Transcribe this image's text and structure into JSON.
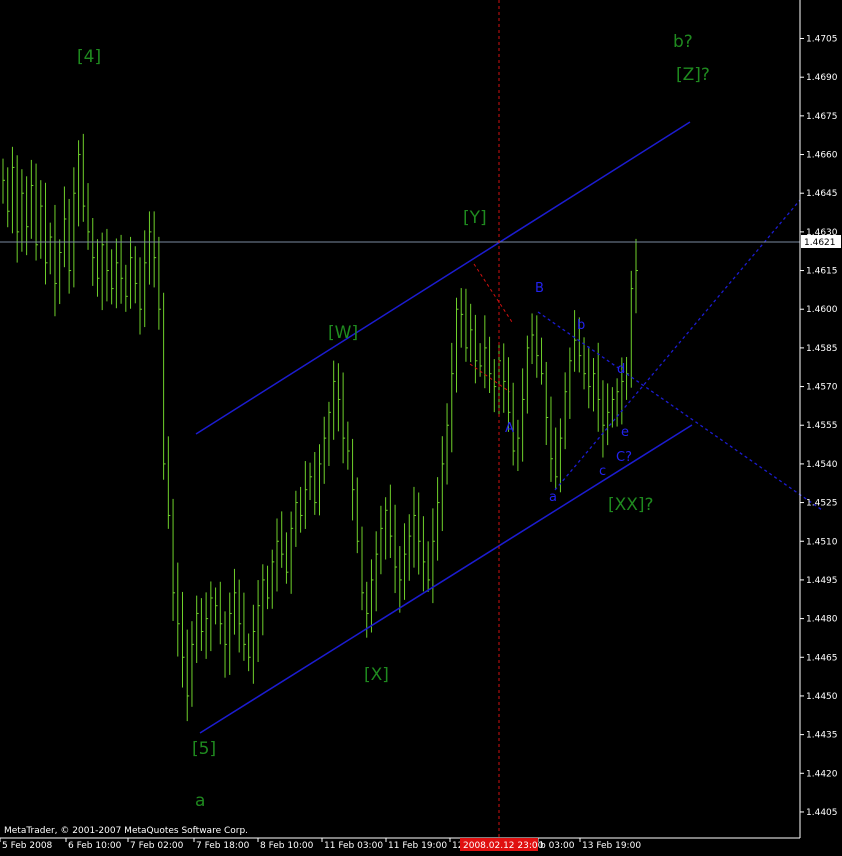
{
  "chart_data": {
    "type": "line",
    "title": "",
    "price_axis": {
      "ticks": [
        "1.4705",
        "1.4690",
        "1.4675",
        "1.4660",
        "1.4645",
        "1.4630",
        "1.4615",
        "1.4600",
        "1.4585",
        "1.4570",
        "1.4555",
        "1.4540",
        "1.4525",
        "1.4510",
        "1.4495",
        "1.4480",
        "1.4465",
        "1.4450",
        "1.4435",
        "1.4420",
        "1.4405"
      ],
      "current_price": "1.4621",
      "ylim": [
        1.4398,
        1.4718
      ]
    },
    "time_axis": {
      "ticks": [
        "5 Feb 2008",
        "6 Feb 10:00",
        "7 Feb 02:00",
        "7 Feb 18:00",
        "8 Feb 10:00",
        "11 Feb 03:00",
        "11 Feb 19:00",
        "12",
        "b 03:00",
        "13 Feb 19:00"
      ],
      "cursor_label": "2008.02.12 23:00"
    },
    "series": [
      {
        "values": [
          1.465,
          1.4638,
          1.4655,
          1.463,
          1.4645,
          1.4632,
          1.4648,
          1.4625,
          1.464,
          1.4618,
          1.4628,
          1.461,
          1.4622,
          1.4635,
          1.4615,
          1.4645,
          1.466,
          1.464,
          1.463,
          1.462,
          1.4612,
          1.4625,
          1.4615,
          1.4608,
          1.4618,
          1.4612,
          1.4605,
          1.462,
          1.461,
          1.46,
          1.4618,
          1.463,
          1.462,
          1.46,
          1.454,
          1.452,
          1.449,
          1.4478,
          1.4465,
          1.445,
          1.447,
          1.4482,
          1.4475,
          1.448,
          1.4488,
          1.4485,
          1.4478,
          1.447,
          1.4482,
          1.449,
          1.4478,
          1.447,
          1.4465,
          1.4475,
          1.4485,
          1.4495,
          1.4488,
          1.4502,
          1.451,
          1.4505,
          1.4498,
          1.4515,
          1.4525,
          1.452,
          1.453,
          1.4535,
          1.4525,
          1.454,
          1.455,
          1.456,
          1.4572,
          1.4565,
          1.455,
          1.4545,
          1.453,
          1.451,
          1.449,
          1.4482,
          1.4495,
          1.4505,
          1.4515,
          1.4522,
          1.4512,
          1.45,
          1.4495,
          1.4505,
          1.4512,
          1.452,
          1.451,
          1.4502,
          1.4495,
          1.451,
          1.4525,
          1.454,
          1.4555,
          1.4575,
          1.46,
          1.4598,
          1.4585,
          1.4592,
          1.458,
          1.4578,
          1.4585,
          1.4575,
          1.457,
          1.458,
          1.4572,
          1.456,
          1.4545,
          1.455,
          1.4565,
          1.4585,
          1.459,
          1.4582,
          1.4575,
          1.4558,
          1.4542,
          1.4535,
          1.455,
          1.4568,
          1.458,
          1.4588,
          1.4582,
          1.4575,
          1.457,
          1.4575,
          1.4565,
          1.4555,
          1.456,
          1.4565,
          1.4568,
          1.4572,
          1.4575,
          1.4608,
          1.4615
        ]
      }
    ],
    "wave_labels": [
      "[4]",
      "[5]",
      "a",
      "[W]",
      "[X]",
      "[Y]",
      "[Z]?",
      "b?",
      "[XX]?",
      "A",
      "B",
      "C?",
      "a",
      "b",
      "c",
      "d",
      "e"
    ],
    "copyright": "MetaTrader, © 2001-2007 MetaQuotes Software Corp.",
    "colors": {
      "background": "#000000",
      "bars": "#6fd12b",
      "labels_green": "#1f8a1f",
      "labels_blue": "#2222ee",
      "channel": "#1c1cd0",
      "cursor_line": "#d01010",
      "cursor_label_bg": "#e01010",
      "price_marker_bg": "#ffffff"
    }
  }
}
